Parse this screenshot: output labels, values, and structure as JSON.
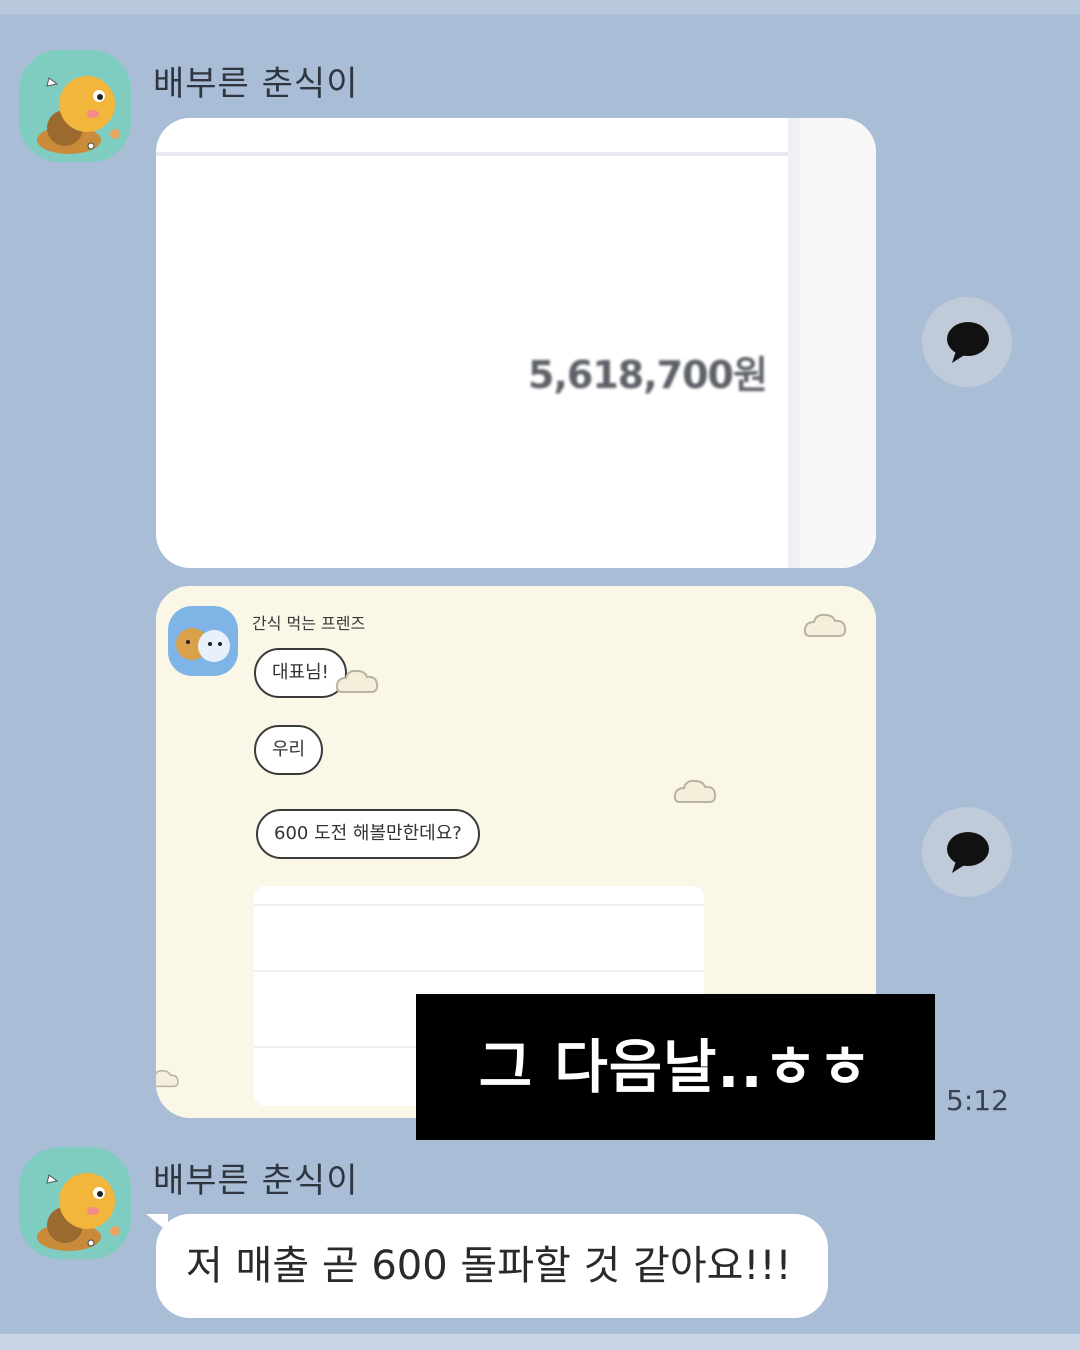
{
  "messages": [
    {
      "sender": "배부른 춘식이",
      "avatar_icon": "choonsik-avatar",
      "image_amount": "5,618,700원"
    },
    {
      "embedded_chat": {
        "room_name": "간식 먹는 프렌즈",
        "bubbles": [
          "대표님!",
          "우리",
          "600 도전 해볼만한데요?"
        ]
      }
    }
  ],
  "timestamp": "5:12",
  "caption": "그 다음날..ㅎㅎ",
  "second_message": {
    "sender": "배부른 춘식이",
    "text": "저 매출 곧 600 돌파할 것 같아요!!!"
  },
  "icons": {
    "share_1": "chat-share-icon",
    "share_2": "chat-share-icon"
  },
  "colors": {
    "background": "#aabdd6",
    "bubble": "#ffffff",
    "avatar_bg": "#7ecdc0"
  }
}
